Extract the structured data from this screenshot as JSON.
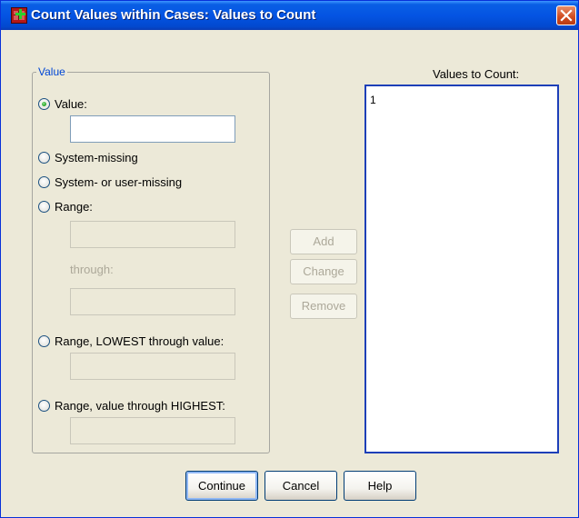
{
  "window": {
    "title": "Count Values within Cases: Values to Count",
    "close_label": "Close",
    "icons": {
      "app": "spss-dataset-add-icon",
      "close": "close-icon"
    }
  },
  "value_group": {
    "legend": "Value",
    "selected_option": "Value:",
    "options": [
      "Value:",
      "System-missing",
      "System- or user-missing",
      "Range:",
      "Range, LOWEST through value:",
      "Range, value through HIGHEST:"
    ],
    "value_input": "",
    "range_from": "",
    "through_label": "through:",
    "range_to": "",
    "lowest_value": "",
    "highest_value": ""
  },
  "actions": {
    "add": "Add",
    "change": "Change",
    "remove": "Remove"
  },
  "values_list": {
    "label": "Values to Count:",
    "items": [
      "1"
    ]
  },
  "footer": {
    "continue": "Continue",
    "cancel": "Cancel",
    "help": "Help"
  },
  "colors": {
    "titlebar": "#0454e3",
    "dialog_bg": "#ece9d8",
    "legend_text": "#0046d5",
    "disabled_text": "#aca899",
    "listbox_border": "#1d3fb8"
  }
}
